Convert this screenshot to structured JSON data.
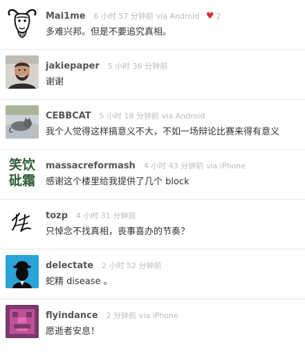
{
  "comments": [
    {
      "username": "Mai1me",
      "time": "6 小时 57 分钟前",
      "via": "via Android",
      "likes": "2",
      "text": "多难兴邦。但是不要追究真相。",
      "avatar": "gnu-head-avatar"
    },
    {
      "username": "jakiepaper",
      "time": "5 小时 36 分钟前",
      "via": "",
      "text": "谢谢",
      "avatar": "bearded-man-photo-avatar"
    },
    {
      "username": "CEBBCAT",
      "time": "5 小时 18 分钟前",
      "via": "via Android",
      "text": "我个人觉得这样搞意义不大，不如一场辩论比赛来得有意义",
      "avatar": "grey-cat-photo-avatar"
    },
    {
      "username": "massacreformash",
      "time": "4 小时 43 分钟前",
      "via": "via iPhone",
      "text": "感谢这个楼里给我提供了几个 block",
      "avatar": "calligraphy-avatar",
      "avatar_text": [
        "笑饮",
        "砒霜"
      ]
    },
    {
      "username": "tozp",
      "time": "4 小时 31 分钟前",
      "via": "",
      "text": "只悼念不找真相，丧事喜办的节奏？",
      "avatar": "signature-avatar"
    },
    {
      "username": "delectate",
      "time": "2 小时 52 分钟前",
      "via": "",
      "text": "蛇精 disease 。",
      "avatar": "bowler-hat-man-avatar"
    },
    {
      "username": "flyindance",
      "time": "2 分钟前",
      "via": "via iPhone",
      "text": "愿逝者安息！",
      "avatar": "pixel-face-avatar"
    }
  ],
  "colors": {
    "username": "#555555",
    "meta": "#bbbbbb",
    "text": "#333333",
    "heart": "#d9302b",
    "divider": "#e6e6e6"
  }
}
